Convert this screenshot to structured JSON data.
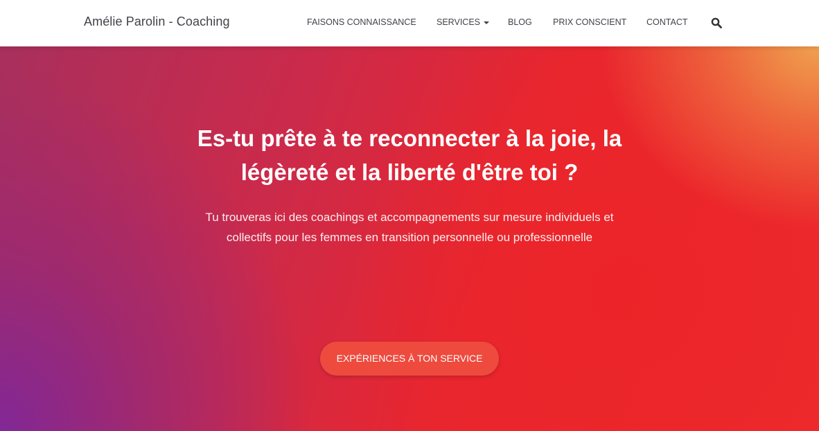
{
  "navbar": {
    "brand": "Amélie Parolin - Coaching",
    "items": [
      {
        "label": "FAISONS CONNAISSANCE"
      },
      {
        "label": "SERVICES"
      },
      {
        "label": "BLOG"
      },
      {
        "label": "PRIX CONSCIENT"
      },
      {
        "label": "CONTACT"
      }
    ],
    "search_icon": "search-icon"
  },
  "hero": {
    "title": "Es-tu prête à te reconnecter à la joie, la légèreté et la liberté d'être toi ?",
    "subtitle": "Tu trouveras ici des coachings et accompagnements sur mesure individuels et collectifs pour les femmes en transition personnelle ou professionnelle",
    "cta_label": "EXPÉRIENCES À TON SERVICE"
  },
  "colors": {
    "navbar_bg": "#ffffff",
    "nav_text": "#404248",
    "cta_bg": "#ee4a3e",
    "gradient_purple": "#823a96",
    "gradient_red": "#ec2628",
    "gradient_orange": "#f0a850"
  }
}
